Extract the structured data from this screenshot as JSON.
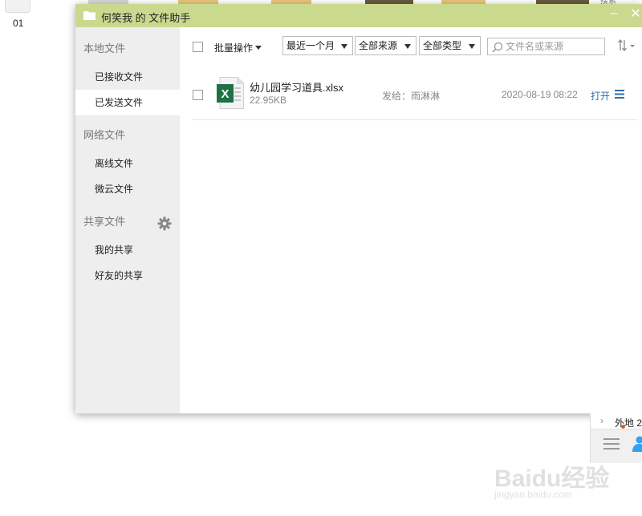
{
  "desktop": {
    "icon_label": "01",
    "search_peek": "搜索"
  },
  "window": {
    "title": "何笑我 的 文件助手",
    "minimize_glyph": "–",
    "close_glyph": "✕"
  },
  "sidebar": {
    "groups": [
      {
        "label": "本地文件",
        "items": [
          "已接收文件",
          "已发送文件"
        ]
      },
      {
        "label": "网络文件",
        "items": [
          "离线文件",
          "微云文件"
        ]
      },
      {
        "label": "共享文件",
        "items": [
          "我的共享",
          "好友的共享"
        ]
      }
    ],
    "active_item": "已发送文件"
  },
  "toolbar": {
    "batch_label": "批量操作",
    "filters": {
      "time": "最近一个月",
      "source": "全部来源",
      "type": "全部类型"
    },
    "search_placeholder": "文件名或来源"
  },
  "files": [
    {
      "name": "幼儿园学习道具.xlsx",
      "size": "22.95KB",
      "sender": "发给：雨淋淋",
      "datetime": "2020-08-19 08:22",
      "action": "打开",
      "icon": "excel-file-icon",
      "icon_letter": "X"
    }
  ],
  "peek_window": {
    "text": "外地 2"
  },
  "watermark": {
    "main": "Baidu经验",
    "sub": "jingyan.baidu.com"
  },
  "colors": {
    "titlebar": "#c9d98e",
    "sidebar": "#eeeeee",
    "link": "#2a6db5",
    "excel": "#1e7145"
  }
}
